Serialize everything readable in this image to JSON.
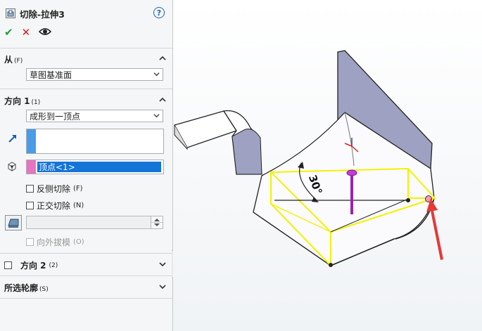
{
  "feature": {
    "title": "切除-拉伸3",
    "icon": "cut-extrude-icon",
    "help_icon": "help-icon",
    "help_label": "?"
  },
  "actions": [
    {
      "icon": "checkmark-icon",
      "symbol": "✔",
      "color": "#1e9e39"
    },
    {
      "icon": "close-icon",
      "symbol": "✕",
      "color": "#d12020"
    },
    {
      "icon": "eye-icon"
    }
  ],
  "from_section": {
    "title": "从",
    "shortcut": "(F)",
    "selected": "草图基准面"
  },
  "direction1": {
    "title": "方向 1",
    "shortcut": "(1)",
    "end_condition": "成形到一顶点",
    "direction_list": "",
    "vertex_list_item": "顶点<1>",
    "flip_side_label": "反侧切除",
    "flip_side_shortcut": "(F)",
    "normal_cut_label": "正交切除",
    "normal_cut_shortcut": "(N)",
    "draft_label": "向外拔模",
    "draft_shortcut": "(O)",
    "accent_blue": "#4a9be8",
    "accent_pink": "#e873c0"
  },
  "direction2": {
    "title": "方向 2",
    "shortcut": "(2)"
  },
  "profiles": {
    "title": "所选轮廓",
    "shortcut": "(S)"
  },
  "viewport": {
    "angle_label": "30°",
    "selection_color": "#f2f200",
    "arrow_color": "#e53935"
  }
}
